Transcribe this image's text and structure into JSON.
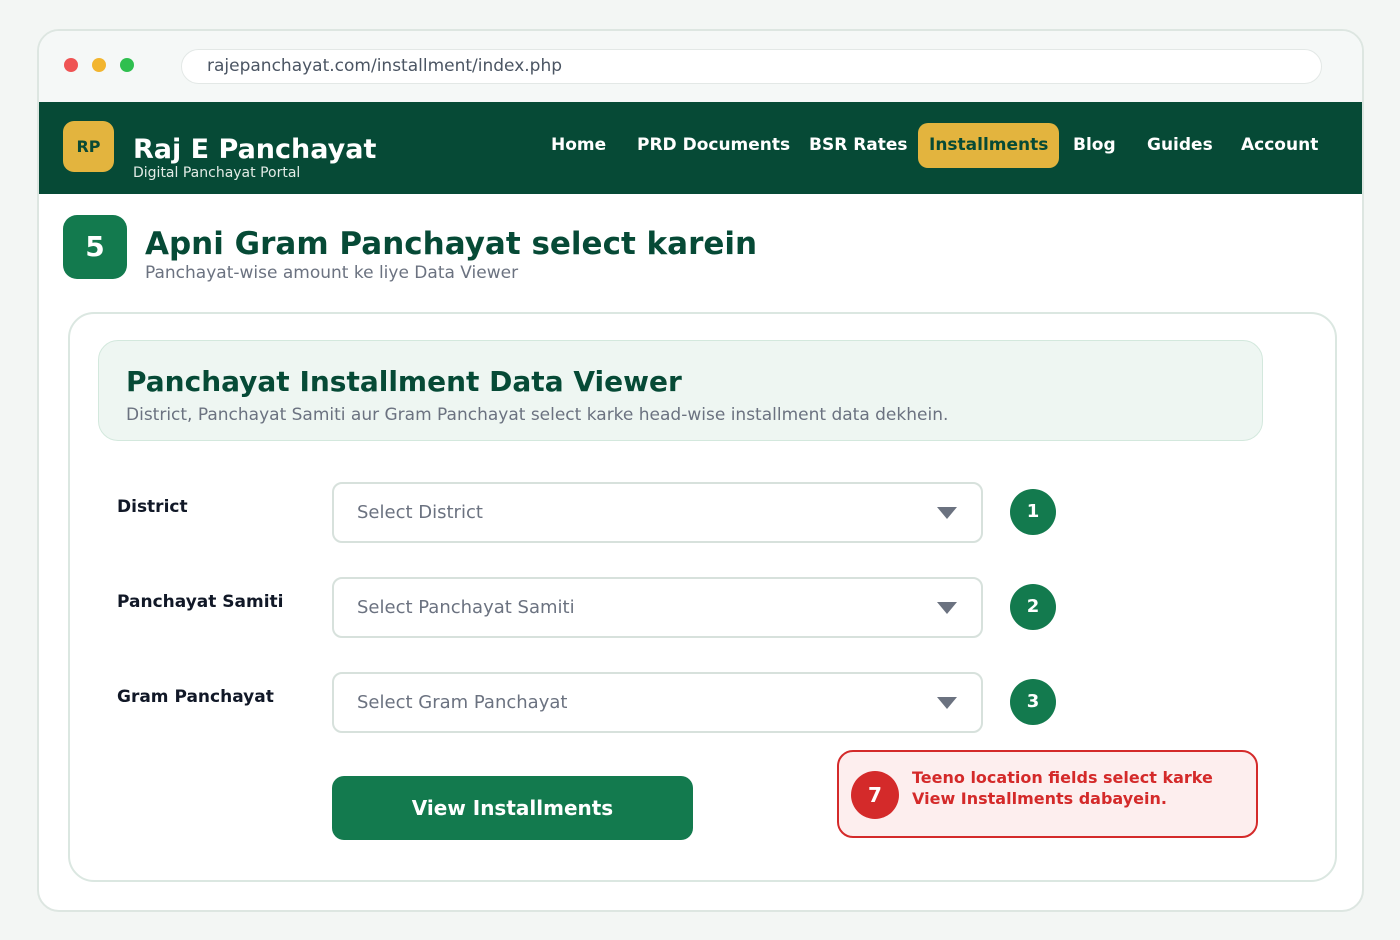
{
  "browser": {
    "url": "rajepanchayat.com/installment/index.php"
  },
  "header": {
    "logo_text": "RP",
    "title": "Raj E Panchayat",
    "subtitle": "Digital Panchayat Portal",
    "nav": [
      {
        "label": "Home",
        "active": false
      },
      {
        "label": "PRD Documents",
        "active": false
      },
      {
        "label": "BSR Rates",
        "active": false
      },
      {
        "label": "Installments",
        "active": true
      },
      {
        "label": "Blog",
        "active": false
      },
      {
        "label": "Guides",
        "active": false
      },
      {
        "label": "Account",
        "active": false
      }
    ]
  },
  "step": {
    "number": "5",
    "title": "Apni Gram Panchayat select karein",
    "subtitle": "Panchayat-wise amount ke liye Data Viewer"
  },
  "viewer": {
    "title": "Panchayat Installment Data Viewer",
    "description": "District, Panchayat Samiti aur Gram Panchayat select karke head-wise installment data dekhein."
  },
  "form": {
    "fields": [
      {
        "label": "District",
        "placeholder": "Select District",
        "step": "1"
      },
      {
        "label": "Panchayat Samiti",
        "placeholder": "Select Panchayat Samiti",
        "step": "2"
      },
      {
        "label": "Gram Panchayat",
        "placeholder": "Select Gram Panchayat",
        "step": "3"
      }
    ],
    "submit_label": "View Installments"
  },
  "callout": {
    "number": "7",
    "text": "Teeno location fields select karke View Installments dabayein."
  },
  "colors": {
    "primary_dark": "#064a36",
    "primary": "#137a4e",
    "accent": "#e3b43e",
    "alert": "#d42a2a"
  }
}
